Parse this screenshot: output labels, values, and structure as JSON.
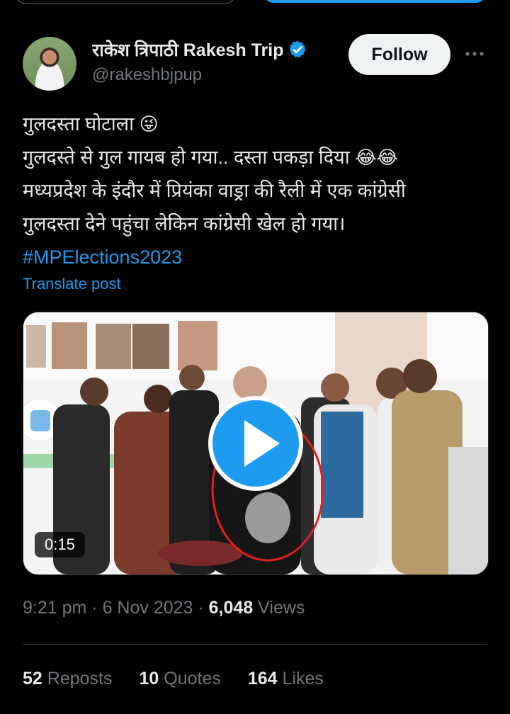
{
  "author": {
    "display_name": "राकेश त्रिपाठी Rakesh Trip",
    "handle": "@rakeshbjpup",
    "verified_icon": "verified-badge-icon"
  },
  "follow_label": "Follow",
  "more_icon": "more-horizontal-icon",
  "tweet": {
    "line1": "गुलदस्ता घोटाला",
    "line1_emoji": "😜",
    "line2": "गुलदस्ते से गुल गायब हो गया.. दस्ता पकड़ा दिया",
    "line2_emoji": "😂😂",
    "line3": "मध्यप्रदेश के इंदौर में प्रियंका वाड्रा की रैली में एक कांग्रेसी",
    "line4": "गुलदस्ता देने पहुंचा लेकिन कांग्रेसी खेल हो गया।",
    "hashtag": "#MPElections2023"
  },
  "translate_label": "Translate post",
  "video": {
    "duration": "0:15",
    "play_icon": "play-icon"
  },
  "meta": {
    "time": "9:21 pm",
    "sep1": " · ",
    "date": "6 Nov 2023",
    "sep2": " · ",
    "views_count": "6,048",
    "views_label": " Views"
  },
  "stats": {
    "reposts_count": "52",
    "reposts_label": " Reposts",
    "quotes_count": "10",
    "quotes_label": " Quotes",
    "likes_count": "164",
    "likes_label": " Likes"
  },
  "colors": {
    "accent": "#1d9bf0",
    "background": "#000000",
    "text_primary": "#e7e9ea",
    "text_secondary": "#71767b"
  }
}
